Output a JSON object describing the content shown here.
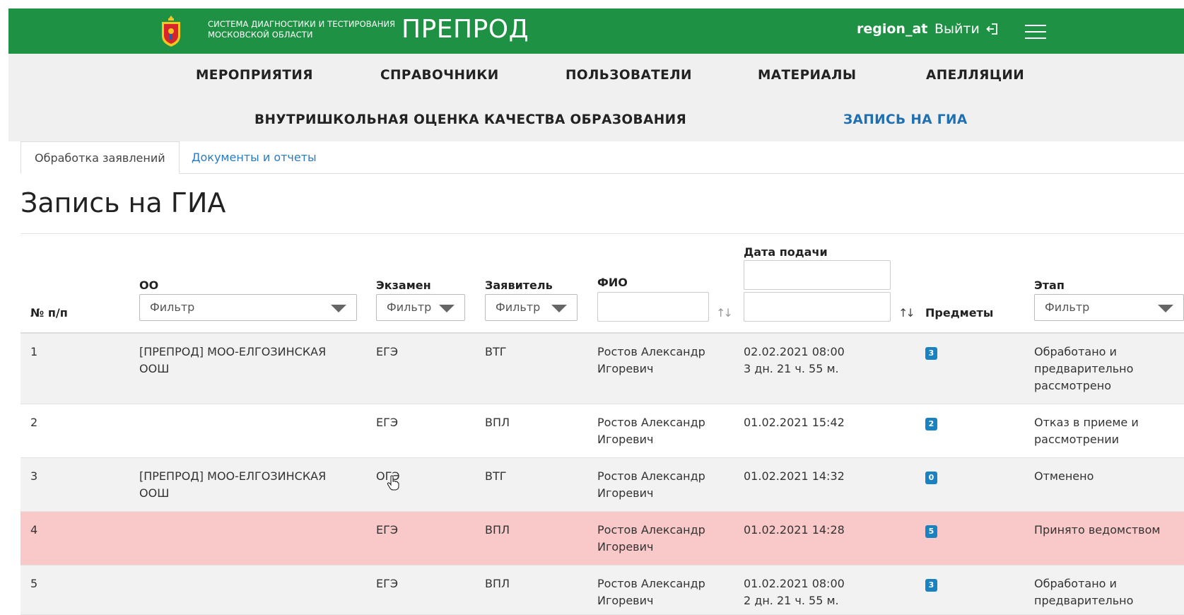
{
  "header": {
    "brand_line1": "СИСТЕМА ДИАГНОСТИКИ И ТЕСТИРОВАНИЯ",
    "brand_line2": "МОСКОВСКОЙ ОБЛАСТИ",
    "brand_name": "ПРЕПРОД",
    "username": "region_at",
    "logout_label": "Выйти",
    "colors": {
      "header_bg": "#1f9144",
      "active_nav": "#1f6fb3",
      "badge": "#1a82c0",
      "highlight_row": "#f9c8c9"
    }
  },
  "nav": {
    "items": [
      "МЕРОПРИЯТИЯ",
      "СПРАВОЧНИКИ",
      "ПОЛЬЗОВАТЕЛИ",
      "МАТЕРИАЛЫ",
      "АПЕЛЛЯЦИИ",
      "ВНУТРИШКОЛЬНАЯ ОЦЕНКА КАЧЕСТВА ОБРАЗОВАНИЯ",
      "ЗАПИСЬ НА ГИА"
    ],
    "active": "ЗАПИСЬ НА ГИА"
  },
  "tabs": [
    "Обработка заявлений",
    "Документы и отчеты"
  ],
  "page_title": "Запись на ГИА",
  "table": {
    "columns": {
      "num": "№ п/п",
      "oo": "ОО",
      "exam": "Экзамен",
      "applicant": "Заявитель",
      "fio": "ФИО",
      "date": "Дата подачи",
      "subjects": "Предметы",
      "stage": "Этап"
    },
    "filter_placeholder": "Фильтр",
    "rows": [
      {
        "num": "1",
        "oo_line1": "[ПРЕПРОД] МОО-ЕЛГОЗИНСКАЯ",
        "oo_line2": "ООШ",
        "exam": "ЕГЭ",
        "applicant": "ВТГ",
        "fio_line1": "Ростов Александр",
        "fio_line2": "Игоревич",
        "date_line1": "02.02.2021 08:00",
        "date_line2": "3 дн. 21 ч. 55 м.",
        "subjects": "3",
        "stage_line1": "Обработано и",
        "stage_line2": "предварительно",
        "stage_line3": "рассмотрено"
      },
      {
        "num": "2",
        "oo_line1": "",
        "oo_line2": "",
        "exam": "ЕГЭ",
        "applicant": "ВПЛ",
        "fio_line1": "Ростов Александр",
        "fio_line2": "Игоревич",
        "date_line1": "01.02.2021 15:42",
        "date_line2": "",
        "subjects": "2",
        "stage_line1": "Отказ в приеме и",
        "stage_line2": "рассмотрении",
        "stage_line3": ""
      },
      {
        "num": "3",
        "oo_line1": "[ПРЕПРОД] МОО-ЕЛГОЗИНСКАЯ",
        "oo_line2": "ООШ",
        "exam": "ОГЭ",
        "applicant": "ВТГ",
        "fio_line1": "Ростов Александр",
        "fio_line2": "Игоревич",
        "date_line1": "01.02.2021 14:32",
        "date_line2": "",
        "subjects": "0",
        "stage_line1": "Отменено",
        "stage_line2": "",
        "stage_line3": ""
      },
      {
        "num": "4",
        "oo_line1": "",
        "oo_line2": "",
        "exam": "ЕГЭ",
        "applicant": "ВПЛ",
        "fio_line1": "Ростов Александр",
        "fio_line2": "Игоревич",
        "date_line1": "01.02.2021 14:28",
        "date_line2": "",
        "subjects": "5",
        "stage_line1": "Принято ведомством",
        "stage_line2": "",
        "stage_line3": ""
      },
      {
        "num": "5",
        "oo_line1": "",
        "oo_line2": "",
        "exam": "ЕГЭ",
        "applicant": "ВПЛ",
        "fio_line1": "Ростов Александр",
        "fio_line2": "Игоревич",
        "date_line1": "01.02.2021 08:00",
        "date_line2": "2 дн. 21 ч. 55 м.",
        "subjects": "3",
        "stage_line1": "Обработано и",
        "stage_line2": "предварительно",
        "stage_line3": ""
      }
    ]
  }
}
